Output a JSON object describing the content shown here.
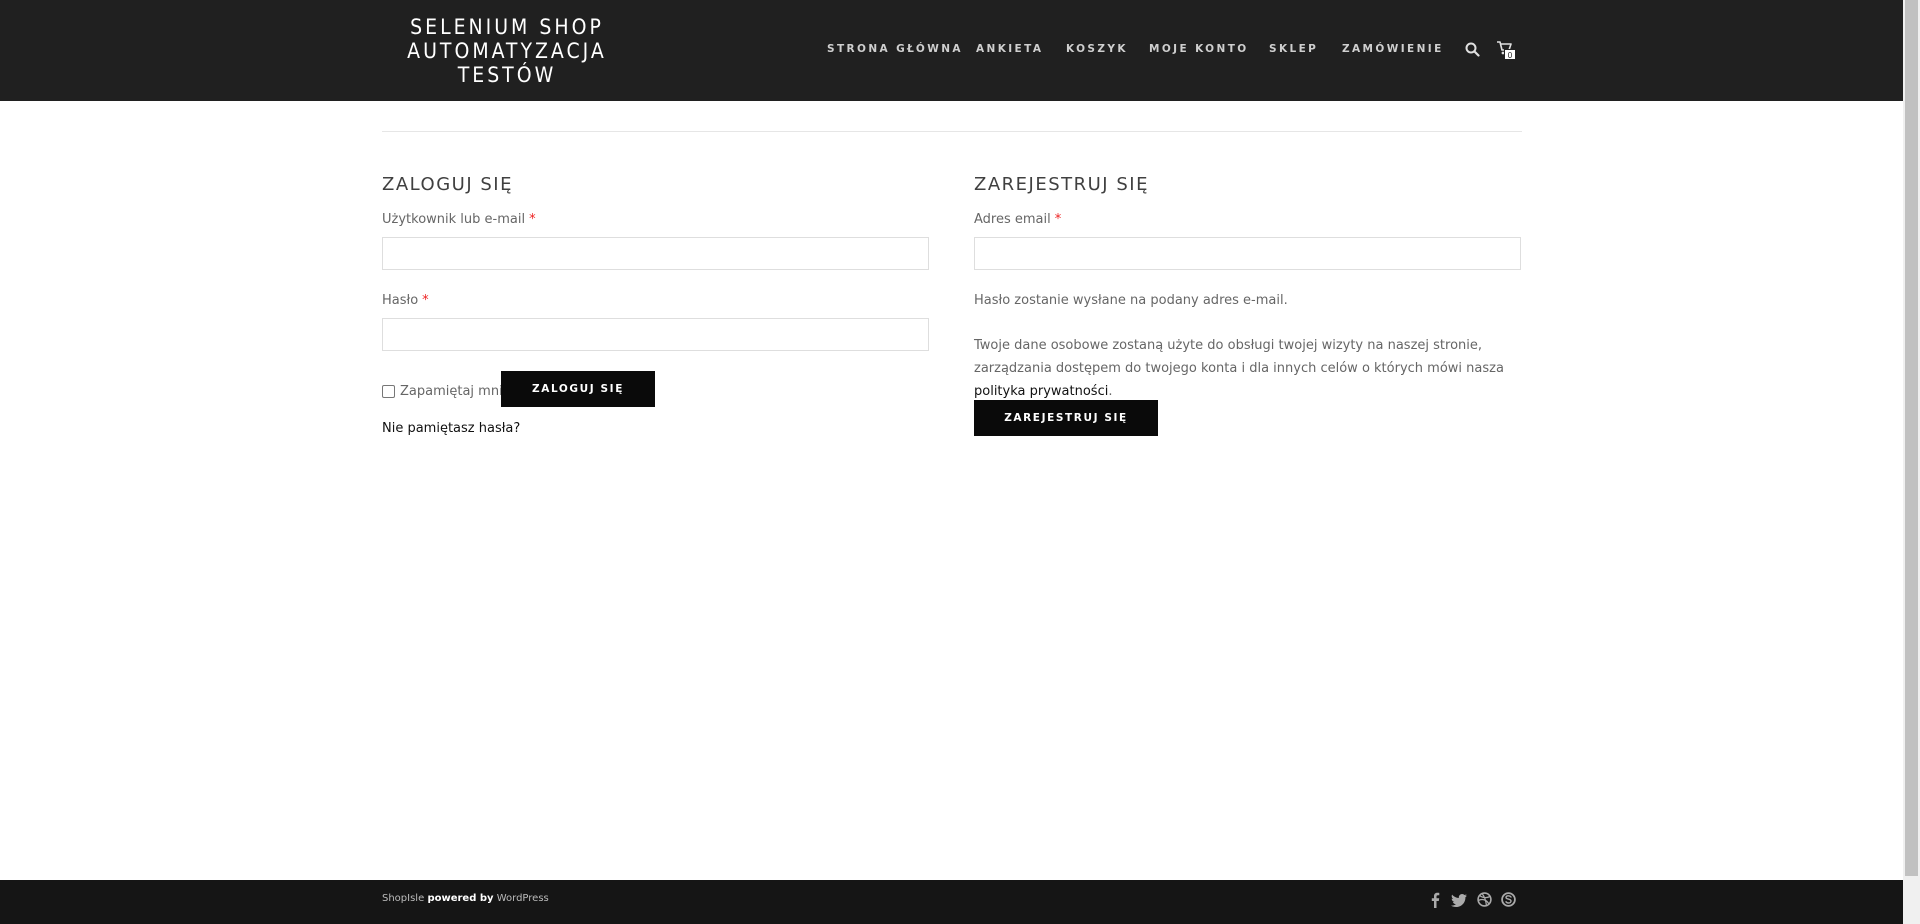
{
  "site": {
    "title_line1": "SELENIUM SHOP",
    "title_line2": "AUTOMATYZACJA",
    "title_line3": "TESTÓW"
  },
  "nav": {
    "items": [
      {
        "label": "STRONA GŁÓWNA"
      },
      {
        "label": "ANKIETA"
      },
      {
        "label": "KOSZYK"
      },
      {
        "label": "MOJE KONTO"
      },
      {
        "label": "SKLEP"
      },
      {
        "label": "ZAMÓWIENIE"
      }
    ],
    "cart_count": "0",
    "icons": [
      "search-icon",
      "cart-icon"
    ]
  },
  "login": {
    "title": "ZALOGUJ SIĘ",
    "username_label": "Użytkownik lub e-mail",
    "username_value": "",
    "password_label": "Hasło",
    "password_value": "",
    "required_mark": "*",
    "remember_label": "Zapamiętaj mnie",
    "submit_label": "ZALOGUJ SIĘ",
    "lost_password": "Nie pamiętasz hasła?"
  },
  "register": {
    "title": "ZAREJESTRUJ SIĘ",
    "email_label": "Adres email",
    "email_value": "",
    "required_mark": "*",
    "password_note": "Hasło zostanie wysłane na podany adres e-mail.",
    "privacy_text": "Twoje dane osobowe zostaną użyte do obsługi twojej wizyty na naszej stronie, zarządzania dostępem do twojego konta i dla innych celów o których mówi nasza",
    "privacy_link": "polityka prywatności",
    "privacy_end": ".",
    "submit_label": "ZAREJESTRUJ SIĘ"
  },
  "footer": {
    "brand": "ShopIsle",
    "powered": "powered by",
    "platform": "WordPress",
    "social_icons": [
      "facebook-icon",
      "twitter-icon",
      "dribbble-icon",
      "skype-icon"
    ]
  },
  "colors": {
    "header_bg": "#202020",
    "footer_bg": "#151515",
    "button_bg": "#0a0a0a",
    "required": "#ee2222"
  }
}
